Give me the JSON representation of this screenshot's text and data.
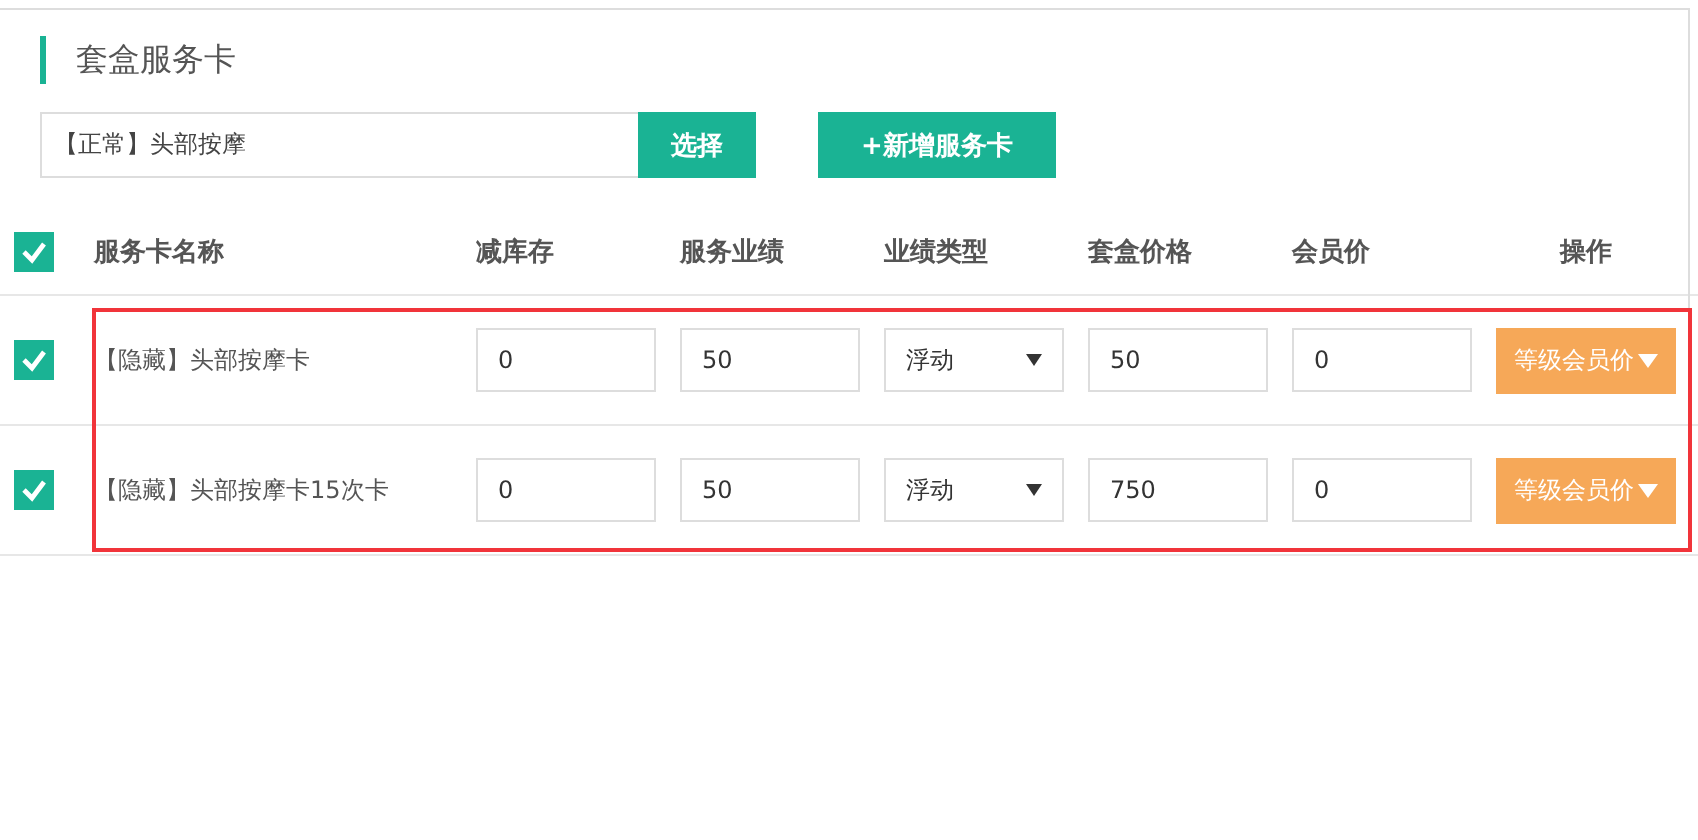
{
  "section": {
    "title": "套盒服务卡"
  },
  "picker": {
    "value": "【正常】头部按摩",
    "select_button": "选择",
    "add_button": "+新增服务卡"
  },
  "table": {
    "all_checked": true,
    "columns": [
      "服务卡名称",
      "减库存",
      "服务业绩",
      "业绩类型",
      "套盒价格",
      "会员价",
      "操作"
    ],
    "rows": [
      {
        "checked": true,
        "name": "【隐藏】头部按摩卡",
        "stock": "0",
        "performance": "50",
        "performance_type": "浮动",
        "package_price": "50",
        "member_price": "0",
        "action": "等级会员价"
      },
      {
        "checked": true,
        "name": "【隐藏】头部按摩卡15次卡",
        "stock": "0",
        "performance": "50",
        "performance_type": "浮动",
        "package_price": "750",
        "member_price": "0",
        "action": "等级会员价"
      }
    ]
  }
}
